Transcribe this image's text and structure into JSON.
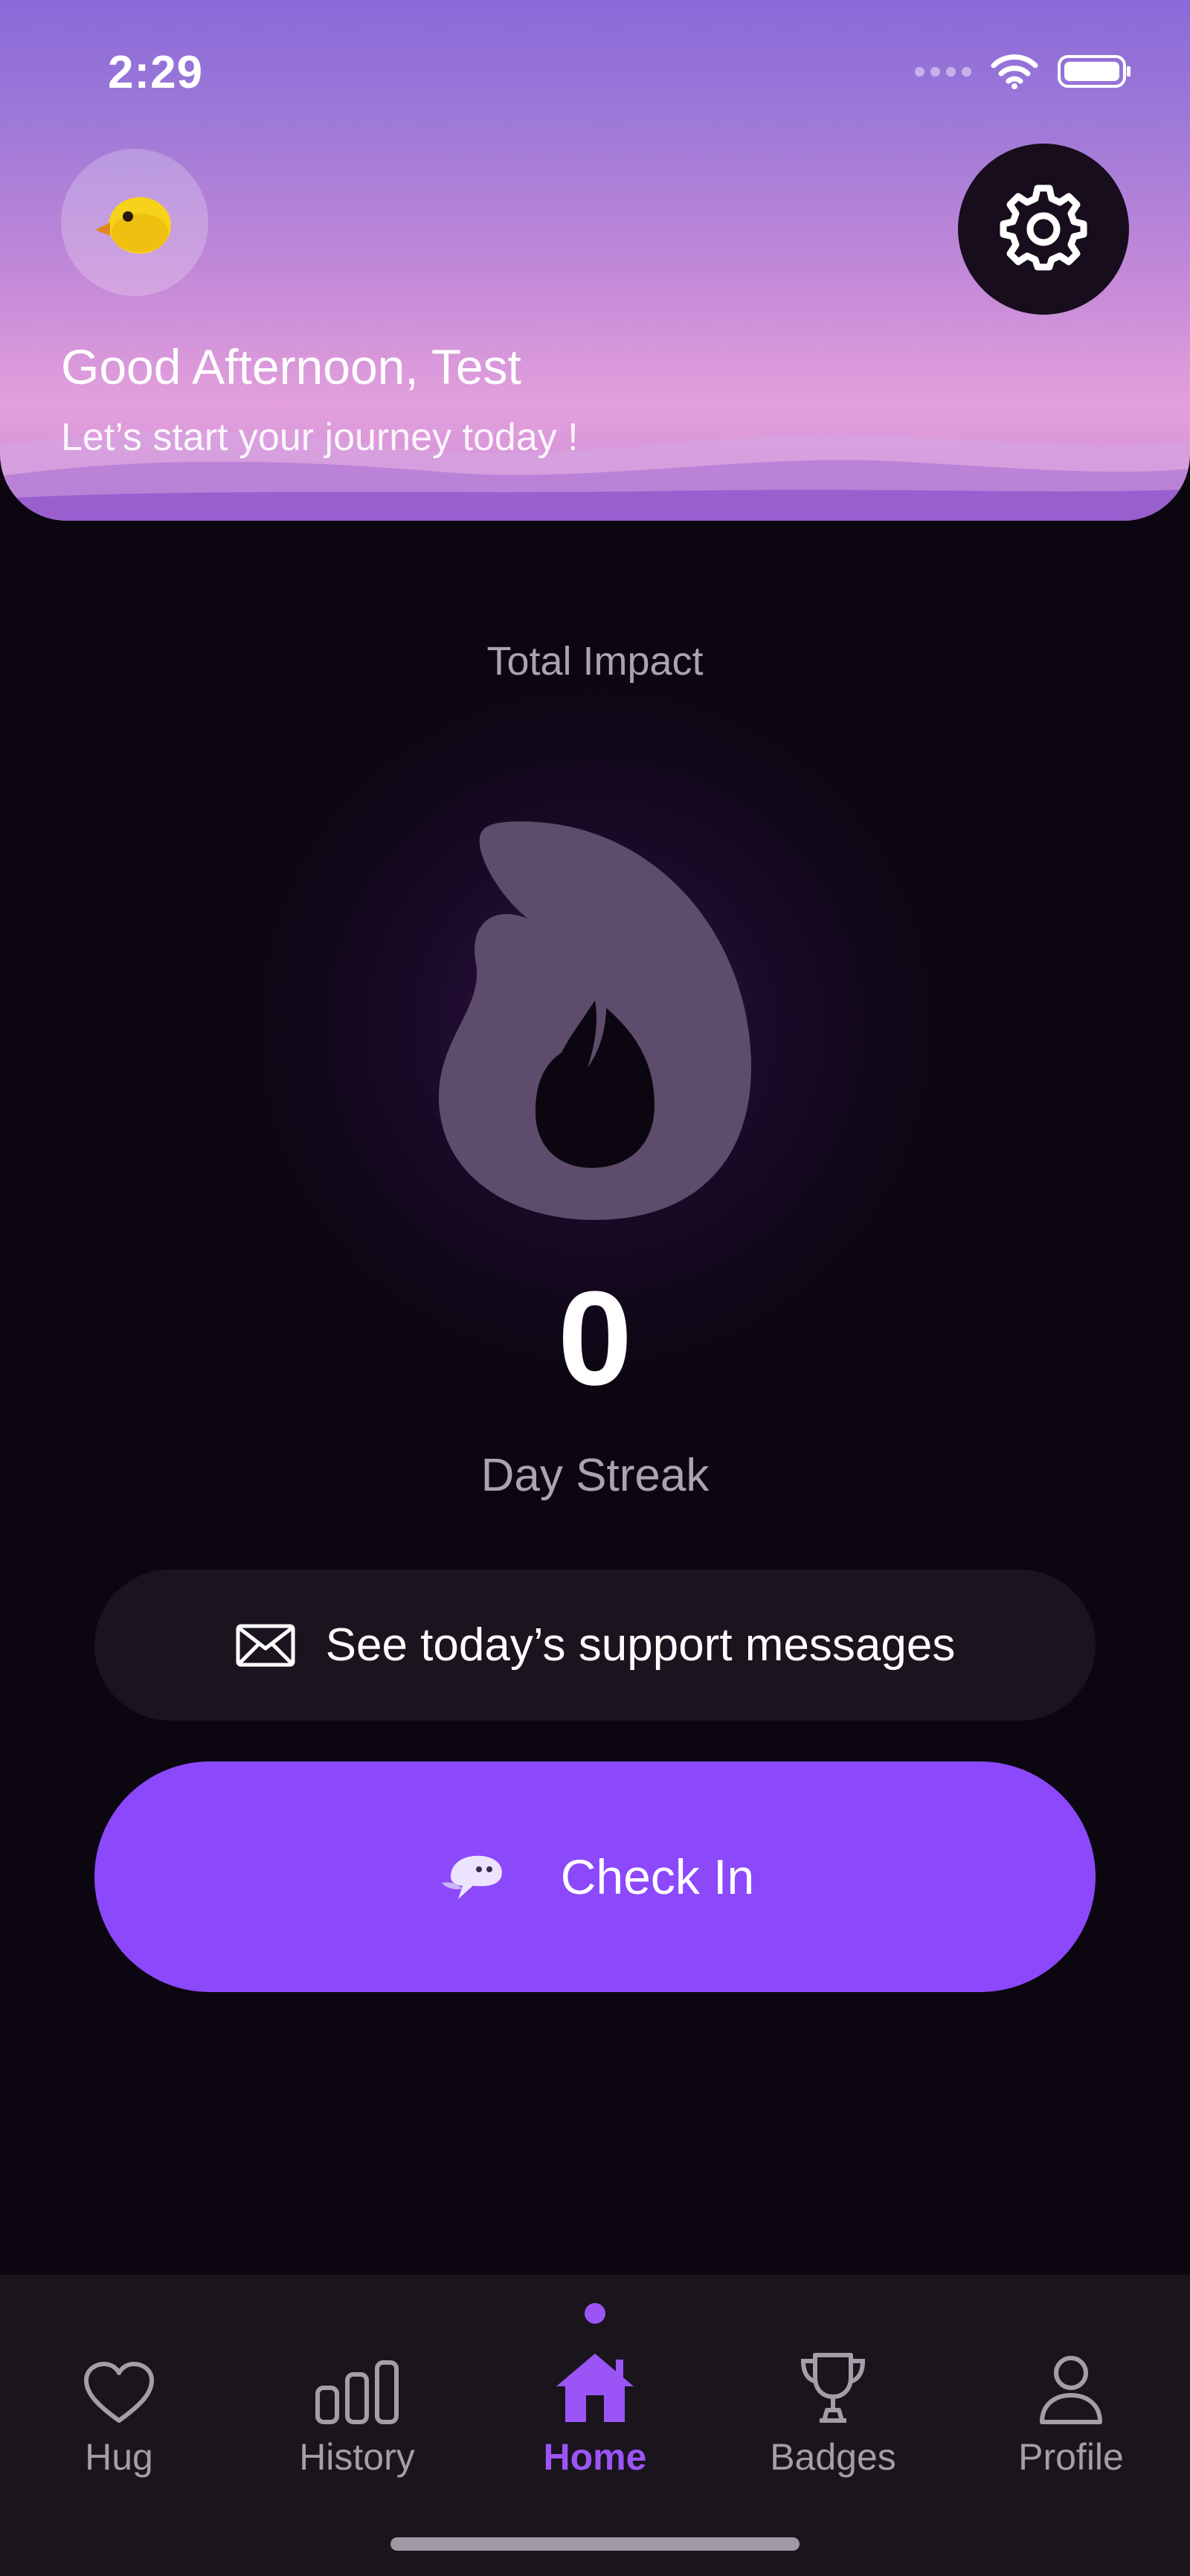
{
  "status_bar": {
    "time": "2:29"
  },
  "header": {
    "avatar_emoji": "🐤",
    "greeting": "Good Afternoon, Test",
    "subtitle": "Let’s start your journey today !"
  },
  "main": {
    "impact_label": "Total Impact",
    "streak_count": "0",
    "streak_label": "Day Streak",
    "support_button_label": "See today’s support messages",
    "checkin_button_label": "Check In"
  },
  "tabs": [
    {
      "label": "Hug",
      "icon": "heart-icon",
      "active": false
    },
    {
      "label": "History",
      "icon": "bar-chart-icon",
      "active": false
    },
    {
      "label": "Home",
      "icon": "home-icon",
      "active": true
    },
    {
      "label": "Badges",
      "icon": "trophy-icon",
      "active": false
    },
    {
      "label": "Profile",
      "icon": "person-icon",
      "active": false
    }
  ],
  "colors": {
    "accent": "#8c48fb",
    "active_tab": "#9b55f6",
    "background": "#0b0610",
    "tab_bar": "#1a141d"
  }
}
